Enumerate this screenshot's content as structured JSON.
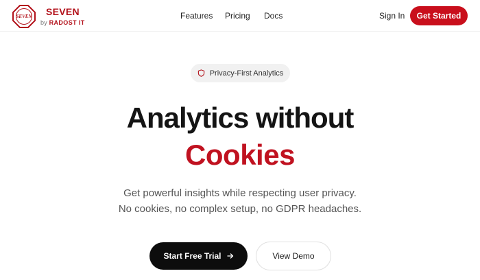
{
  "brand": {
    "logo_text": "SEVEN",
    "name": "SEVEN",
    "by_prefix": "by",
    "company": "RADOST IT"
  },
  "nav": {
    "links": [
      "Features",
      "Pricing",
      "Docs"
    ],
    "sign_in": "Sign In",
    "cta": "Get Started"
  },
  "hero": {
    "badge_icon": "shield-icon",
    "badge": "Privacy-First Analytics",
    "headline": "Analytics without",
    "headline_accent": "Cookies",
    "subtitle_line1": "Get powerful insights while respecting user privacy.",
    "subtitle_line2": "No cookies, no complex setup, no GDPR headaches.",
    "primary_button": "Start Free Trial",
    "primary_button_icon": "arrow-right-icon",
    "secondary_button": "View Demo"
  },
  "colors": {
    "brand_red": "#c90f1c",
    "dark": "#0d0d0d",
    "muted_text": "#555555",
    "pill_bg": "#f1f1f1"
  }
}
